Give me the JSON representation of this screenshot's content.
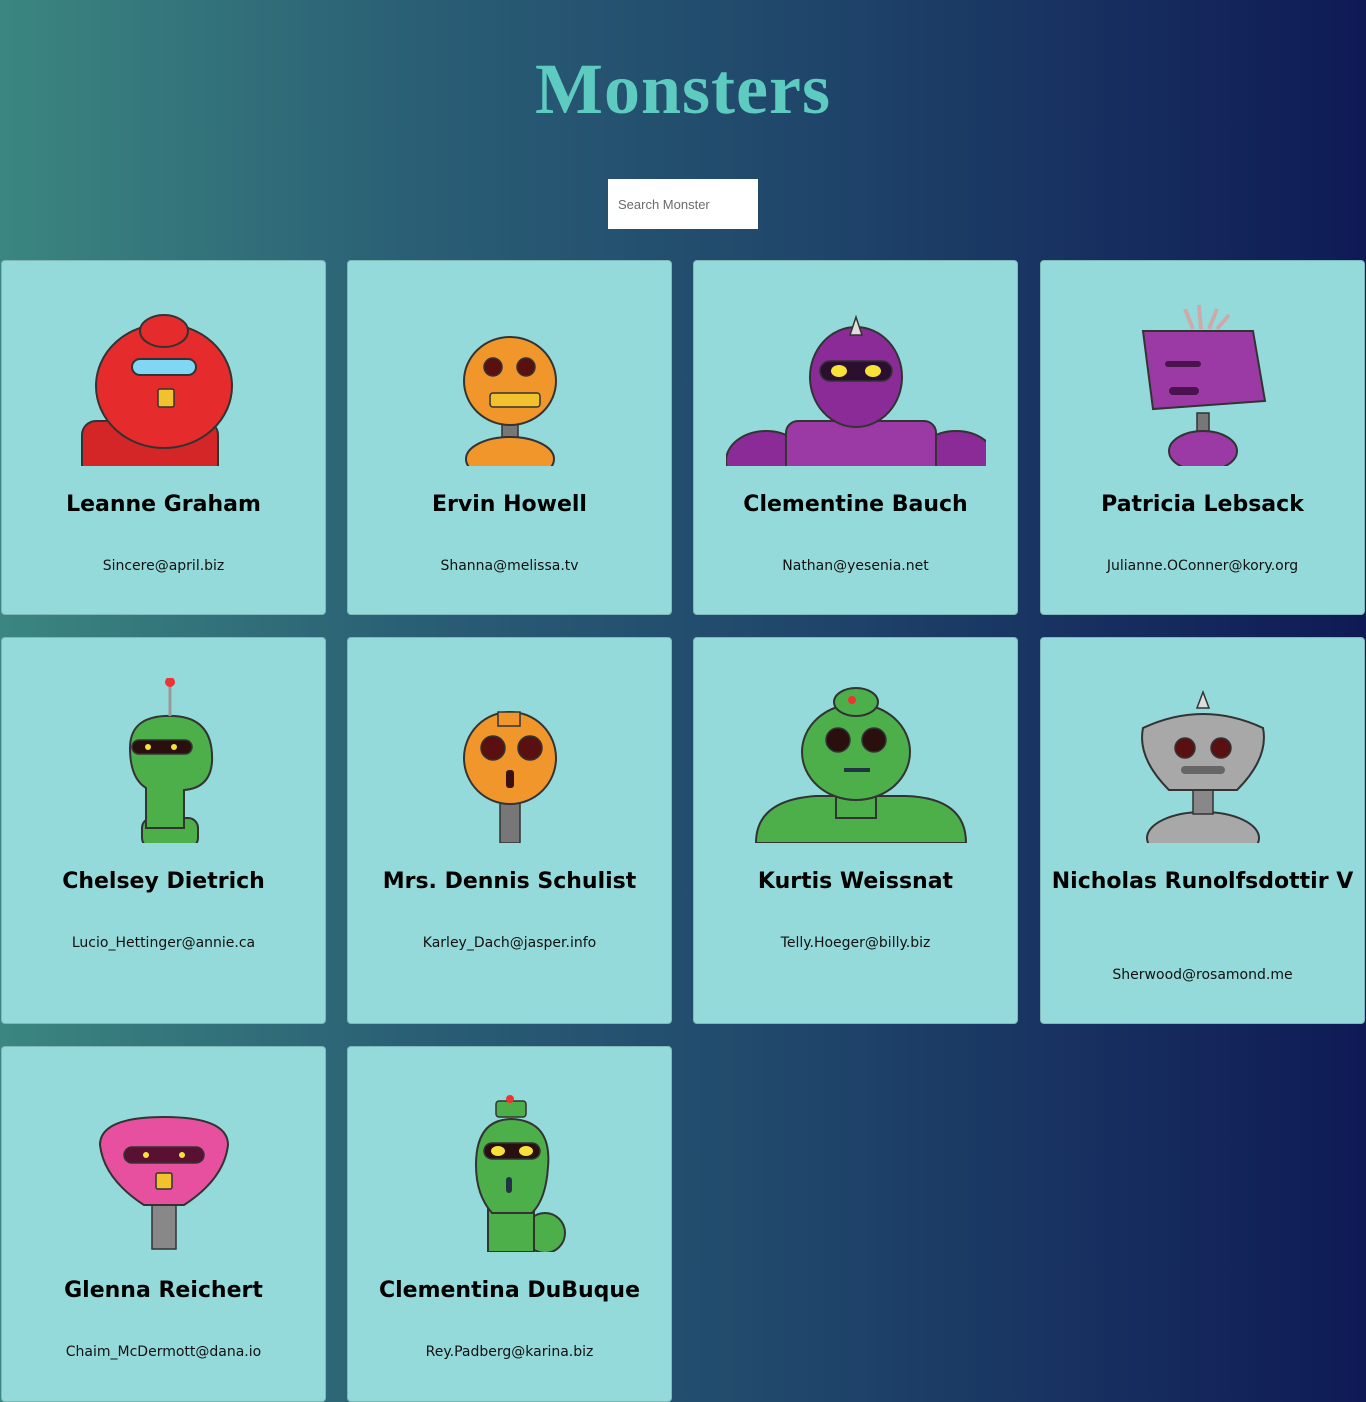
{
  "header": {
    "title": "Monsters"
  },
  "search": {
    "placeholder": "Search Monster",
    "value": ""
  },
  "monsters": [
    {
      "name": "Leanne Graham",
      "email": "Sincere@april.biz",
      "color": "#e52b2b"
    },
    {
      "name": "Ervin Howell",
      "email": "Shanna@melissa.tv",
      "color": "#f0962a"
    },
    {
      "name": "Clementine Bauch",
      "email": "Nathan@yesenia.net",
      "color": "#8a2b97"
    },
    {
      "name": "Patricia Lebsack",
      "email": "Julianne.OConner@kory.org",
      "color": "#9b3aa5"
    },
    {
      "name": "Chelsey Dietrich",
      "email": "Lucio_Hettinger@annie.ca",
      "color": "#4caf4a"
    },
    {
      "name": "Mrs. Dennis Schulist",
      "email": "Karley_Dach@jasper.info",
      "color": "#f0962a"
    },
    {
      "name": "Kurtis Weissnat",
      "email": "Telly.Hoeger@billy.biz",
      "color": "#4caf4a"
    },
    {
      "name": "Nicholas Runolfsdottir V",
      "email": "Sherwood@rosamond.me",
      "color": "#a8a8a8"
    },
    {
      "name": "Glenna Reichert",
      "email": "Chaim_McDermott@dana.io",
      "color": "#e7509e"
    },
    {
      "name": "Clementina DuBuque",
      "email": "Rey.Padberg@karina.biz",
      "color": "#4caf4a"
    }
  ]
}
